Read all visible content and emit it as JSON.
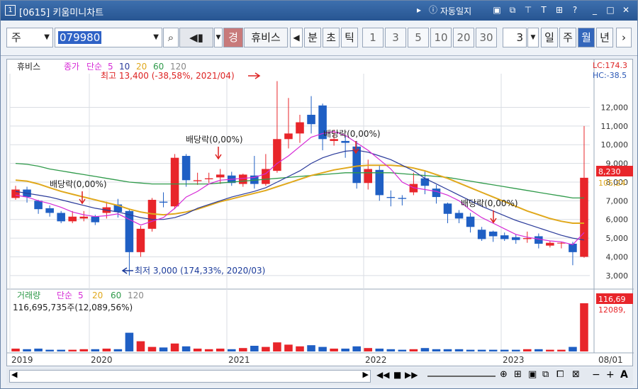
{
  "window": {
    "number": "1",
    "title": "[0615] 키움미니차트",
    "auto_save": "자동일지"
  },
  "toolbar": {
    "period_type": "주",
    "code": "079980",
    "stock_name": "휴비스",
    "badge": "경",
    "intervals": [
      "분",
      "초",
      "틱"
    ],
    "ticks": [
      "1",
      "3",
      "5",
      "10",
      "20",
      "30"
    ],
    "count": "3",
    "periods": [
      "일",
      "주",
      "월",
      "년"
    ],
    "active_period": "월"
  },
  "legend": {
    "name": "휴비스",
    "price_type": "종가",
    "ma_type": "단순",
    "ma_periods": [
      "5",
      "10",
      "20",
      "60",
      "120"
    ],
    "lc": "LC:174.3",
    "hc": "HC:-38.5"
  },
  "volume_legend": {
    "label": "거래량",
    "ma_type": "단순",
    "ma_periods": [
      "5",
      "20",
      "60",
      "120"
    ],
    "value_text": "116,695,735주(12,089,56%)",
    "right_value": "116,69",
    "right_sub": "12089,"
  },
  "annotations": {
    "high": "최고 13,400 (-38,58%, 2021/04)",
    "low": "최저 3,000 (174,33%, 2020/03)",
    "dividend": "배당락(0,00%)",
    "current_price": "8,230",
    "current_ma": "105,24"
  },
  "colors": {
    "up": "#e8252a",
    "down": "#1f5fc4",
    "ma5": "#d62ad6",
    "ma10": "#2a3a9a",
    "ma20": "#e0a81c",
    "ma60": "#2f9a4a",
    "grid": "#d9dde3"
  },
  "chart_data": {
    "type": "candlestick",
    "x_labels": [
      "2019",
      "2020",
      "2021",
      "2022",
      "2023",
      "08/01"
    ],
    "y_ticks": [
      3000,
      4000,
      5000,
      6000,
      7000,
      8000,
      9000,
      10000,
      11000,
      12000
    ],
    "ylim": [
      2500,
      13800
    ],
    "candles": [
      [
        7150,
        7600,
        7800,
        7050
      ],
      [
        7600,
        7200,
        7750,
        6900
      ],
      [
        7000,
        6550,
        7050,
        6300
      ],
      [
        6600,
        6350,
        6750,
        6150
      ],
      [
        6350,
        5900,
        6450,
        5800
      ],
      [
        5900,
        6150,
        6450,
        5800
      ],
      [
        6050,
        6150,
        6450,
        5900
      ],
      [
        6150,
        5850,
        6250,
        5700
      ],
      [
        6350,
        6650,
        6950,
        6050
      ],
      [
        6800,
        6400,
        7100,
        6100
      ],
      [
        6450,
        4250,
        6550,
        3000
      ],
      [
        4250,
        5500,
        5650,
        4000
      ],
      [
        5500,
        7050,
        7150,
        5350
      ],
      [
        6950,
        6900,
        7450,
        6650
      ],
      [
        6700,
        9300,
        9500,
        6550
      ],
      [
        9400,
        8100,
        9500,
        7750
      ],
      [
        8050,
        8100,
        8500,
        7850
      ],
      [
        8150,
        8200,
        8500,
        7950
      ],
      [
        8250,
        8400,
        8700,
        7900
      ],
      [
        8350,
        7950,
        8550,
        7800
      ],
      [
        7900,
        8400,
        8450,
        7750
      ],
      [
        8350,
        7900,
        9400,
        7650
      ],
      [
        7900,
        8700,
        9500,
        7800
      ],
      [
        8600,
        10300,
        13400,
        8500
      ],
      [
        10300,
        10600,
        12500,
        9800
      ],
      [
        10600,
        11200,
        11600,
        10100
      ],
      [
        11600,
        11100,
        12600,
        10600
      ],
      [
        12100,
        10300,
        12200,
        9700
      ],
      [
        10200,
        10300,
        10800,
        9950
      ],
      [
        10200,
        10100,
        10500,
        9300
      ],
      [
        9900,
        7950,
        10200,
        7650
      ],
      [
        7950,
        8700,
        9200,
        7600
      ],
      [
        8650,
        7300,
        8900,
        7000
      ],
      [
        7200,
        7150,
        7550,
        6700
      ],
      [
        7150,
        7100,
        7300,
        6750
      ],
      [
        7450,
        7900,
        8500,
        7300
      ],
      [
        8200,
        7800,
        8600,
        7350
      ],
      [
        7650,
        7200,
        7850,
        6850
      ],
      [
        6850,
        6300,
        6900,
        5800
      ],
      [
        6350,
        6050,
        6500,
        5800
      ],
      [
        6150,
        5600,
        6350,
        5300
      ],
      [
        5450,
        4950,
        5600,
        4850
      ],
      [
        5350,
        5100,
        5400,
        4800
      ],
      [
        5150,
        4950,
        5300,
        4850
      ],
      [
        5050,
        4900,
        5200,
        4700
      ],
      [
        4950,
        5000,
        5350,
        4750
      ],
      [
        5100,
        4700,
        5250,
        4450
      ],
      [
        4600,
        4750,
        4850,
        4500
      ],
      [
        4750,
        4750,
        4800,
        4450
      ],
      [
        4700,
        4250,
        4800,
        3550
      ],
      [
        4000,
        8230,
        11000,
        3950
      ]
    ],
    "ma5": [
      7300,
      7200,
      7000,
      6850,
      6650,
      6400,
      6250,
      6150,
      6200,
      6300,
      6000,
      5700,
      5900,
      6100,
      6600,
      7200,
      7500,
      7900,
      8100,
      8150,
      8200,
      8250,
      8450,
      9000,
      9400,
      9900,
      10400,
      10600,
      10700,
      10500,
      10100,
      9700,
      9200,
      8700,
      8000,
      7700,
      7600,
      7500,
      7300,
      7000,
      6500,
      6100,
      5800,
      5500,
      5200,
      5050,
      4950,
      4850,
      4800,
      4650,
      5300
    ],
    "ma10": [
      7500,
      7400,
      7300,
      7200,
      7050,
      6900,
      6750,
      6600,
      6500,
      6400,
      6250,
      6100,
      6000,
      6000,
      6100,
      6300,
      6600,
      6800,
      7000,
      7200,
      7350,
      7500,
      7700,
      8000,
      8300,
      8600,
      9000,
      9300,
      9500,
      9650,
      9700,
      9600,
      9400,
      9200,
      8900,
      8600,
      8200,
      7900,
      7600,
      7300,
      7000,
      6700,
      6450,
      6200,
      5950,
      5750,
      5550,
      5350,
      5150,
      5000,
      4900
    ],
    "ma20": [
      8100,
      8050,
      7900,
      7700,
      7500,
      7350,
      7200,
      7050,
      6900,
      6750,
      6550,
      6400,
      6300,
      6250,
      6300,
      6400,
      6550,
      6750,
      6950,
      7100,
      7250,
      7400,
      7550,
      7750,
      7950,
      8150,
      8350,
      8500,
      8650,
      8750,
      8850,
      8900,
      8900,
      8900,
      8850,
      8750,
      8600,
      8400,
      8200,
      7950,
      7700,
      7450,
      7200,
      6950,
      6700,
      6450,
      6250,
      6050,
      5900,
      5800,
      5800
    ],
    "ma60": [
      9000,
      8950,
      8850,
      8700,
      8600,
      8500,
      8400,
      8300,
      8200,
      8100,
      8000,
      7950,
      7900,
      7900,
      7900,
      7900,
      7900,
      7900,
      7950,
      8000,
      8050,
      8100,
      8150,
      8200,
      8250,
      8300,
      8350,
      8400,
      8450,
      8500,
      8500,
      8500,
      8500,
      8500,
      8450,
      8400,
      8350,
      8300,
      8250,
      8150,
      8050,
      7950,
      7850,
      7750,
      7650,
      7550,
      7450,
      7350,
      7250,
      7150,
      7150
    ],
    "volume": [
      0.5,
      0.4,
      0.5,
      0.3,
      0.3,
      0.3,
      0.4,
      0.4,
      0.5,
      0.4,
      3.3,
      1.8,
      0.8,
      0.7,
      1.4,
      0.9,
      0.5,
      0.4,
      0.5,
      0.4,
      0.6,
      1.0,
      0.8,
      1.6,
      1.2,
      0.9,
      1.1,
      0.8,
      0.5,
      0.5,
      0.9,
      0.6,
      0.5,
      0.4,
      0.3,
      0.4,
      0.6,
      0.4,
      0.4,
      0.4,
      0.3,
      0.3,
      0.3,
      0.3,
      0.3,
      0.4,
      0.4,
      0.3,
      0.3,
      0.8,
      8.5
    ],
    "vol_max": 9
  }
}
